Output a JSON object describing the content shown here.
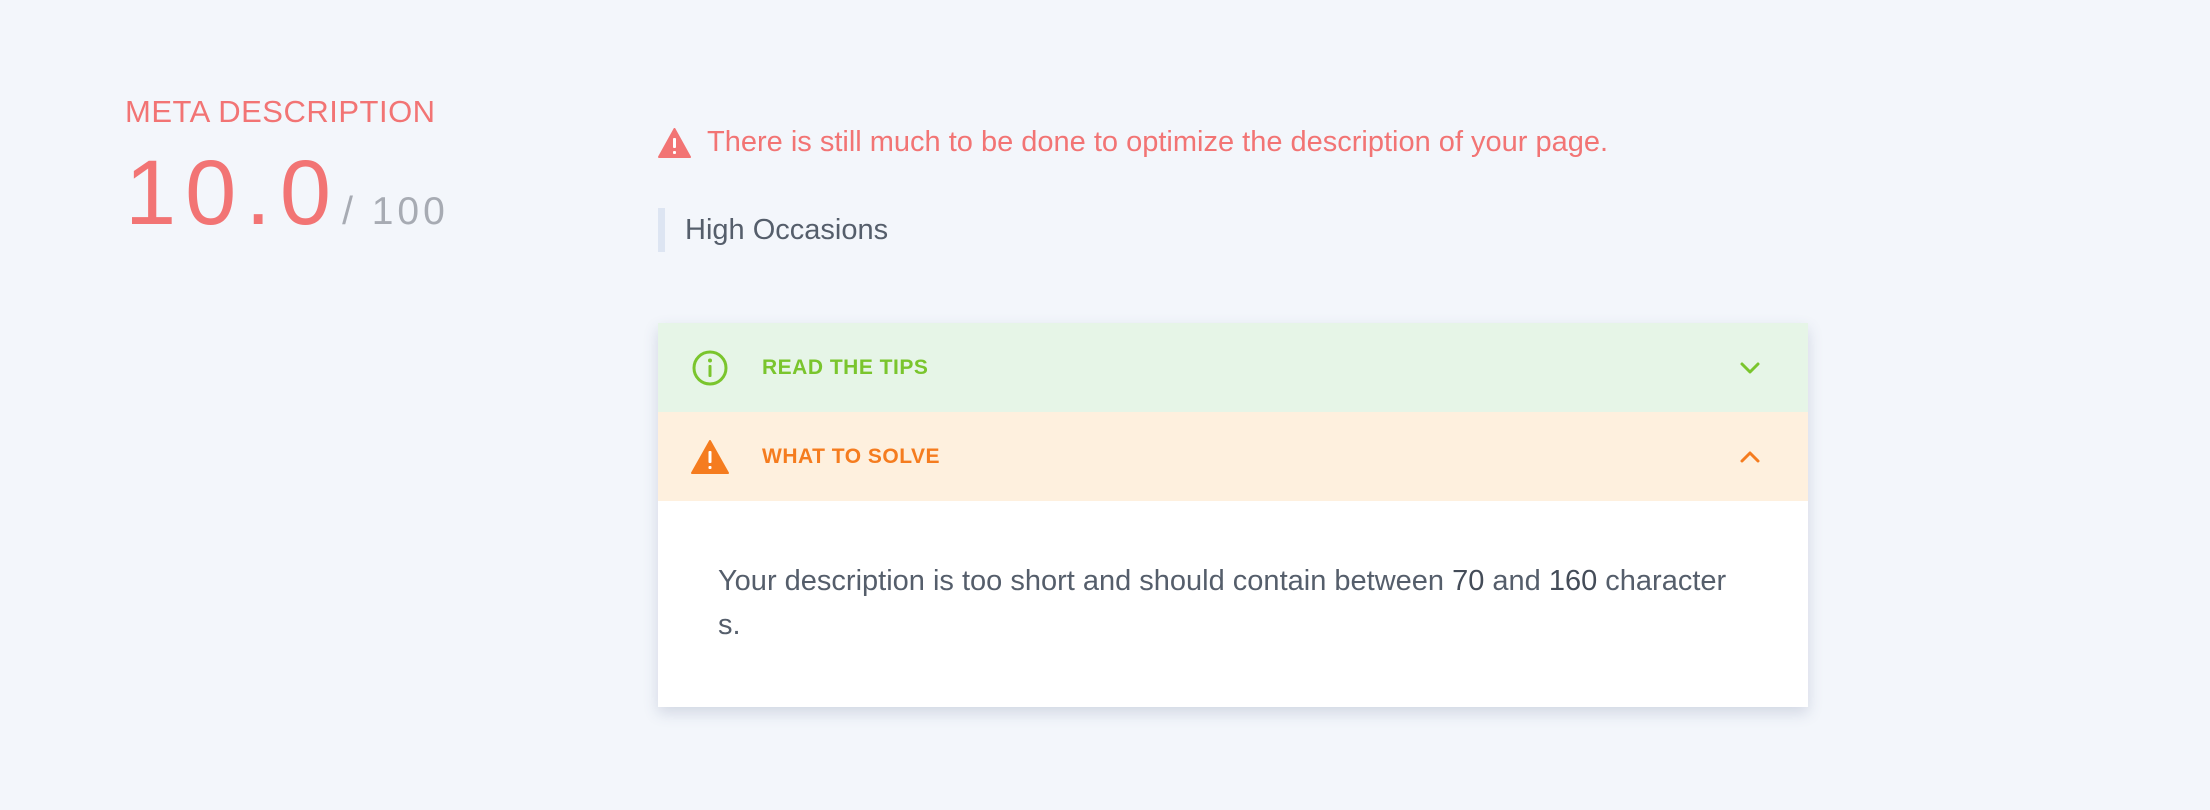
{
  "score": {
    "label": "META DESCRIPTION",
    "value": "10.0",
    "max": "/ 100"
  },
  "status": {
    "icon": "warning-triangle-icon",
    "message": "There is still much to be done to optimize the description of your page."
  },
  "current_description": "High Occasions",
  "accordion": {
    "tips": {
      "icon": "info-circle-icon",
      "title": "READ THE TIPS",
      "state": "collapsed",
      "color": "#7ac52d"
    },
    "solve": {
      "icon": "warning-triangle-icon",
      "title": "WHAT TO SOLVE",
      "state": "expanded",
      "color": "#f57c1f",
      "body": {
        "text_before": "Your description is too short and should contain between ",
        "min": "70",
        "text_middle": " and ",
        "max": "160",
        "text_after": " characters."
      }
    }
  },
  "colors": {
    "page_background": "#f3f6fb",
    "alert": "#f27474",
    "tips_background": "#e6f5e7",
    "solve_background": "#fef0de"
  }
}
